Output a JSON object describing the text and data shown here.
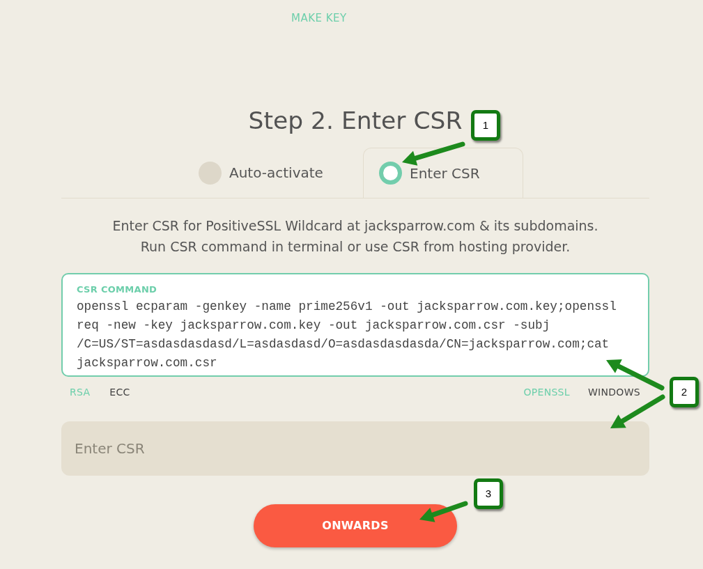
{
  "top_link": {
    "label": "MAKE KEY"
  },
  "title": "Step 2. Enter CSR",
  "mode_tabs": [
    {
      "label": "Auto-activate",
      "selected": false
    },
    {
      "label": "Enter CSR",
      "selected": true
    }
  ],
  "description_lines": [
    "Enter CSR for PositiveSSL Wildcard at jacksparrow.com & its subdomains.",
    "Run CSR command in terminal or use CSR from hosting provider."
  ],
  "csr_command": {
    "label": "CSR COMMAND",
    "lines": [
      "openssl ecparam -genkey -name prime256v1 -out jacksparrow.com.key;openssl",
      "req -new -key jacksparrow.com.key -out jacksparrow.com.csr -subj",
      "/C=US/ST=asdasdasdasd/L=asdasdasd/O=asdasdasdasda/CN=jacksparrow.com;cat",
      "jacksparrow.com.csr"
    ]
  },
  "key_types": [
    {
      "label": "RSA",
      "selected": true
    },
    {
      "label": "ECC",
      "selected": false
    }
  ],
  "platforms": [
    {
      "label": "OPENSSL",
      "selected": true
    },
    {
      "label": "WINDOWS",
      "selected": false
    }
  ],
  "csr_field": {
    "placeholder": "Enter CSR"
  },
  "submit_button": {
    "label": "ONWARDS"
  },
  "annotations": [
    {
      "label": "1"
    },
    {
      "label": "2"
    },
    {
      "label": "3"
    }
  ]
}
